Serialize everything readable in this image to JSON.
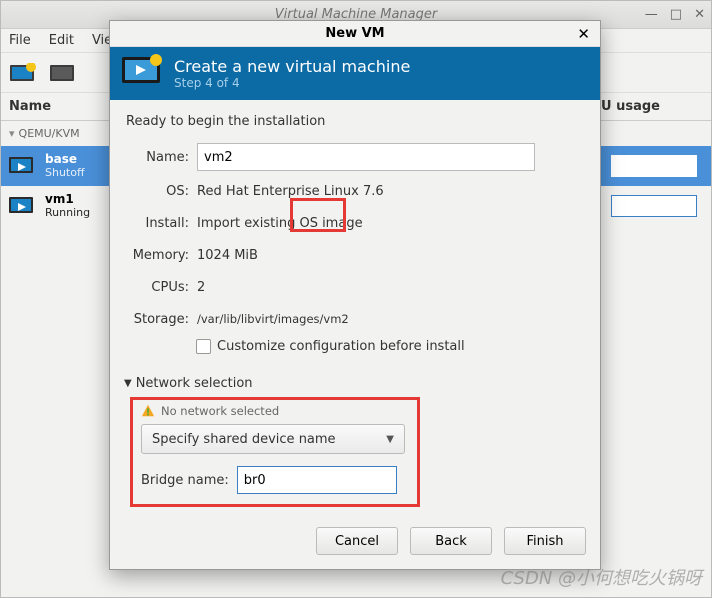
{
  "main_window": {
    "title": "Virtual Machine Manager",
    "menu": {
      "file": "File",
      "edit": "Edit",
      "view": "Vie"
    },
    "columns": {
      "name": "Name",
      "cpu": "U usage"
    },
    "connection": "QEMU/KVM",
    "vms": [
      {
        "name": "base",
        "state": "Shutoff",
        "selected": true
      },
      {
        "name": "vm1",
        "state": "Running",
        "selected": false
      }
    ]
  },
  "dialog": {
    "title": "New VM",
    "banner": {
      "heading": "Create a new virtual machine",
      "step": "Step 4 of 4"
    },
    "ready": "Ready to begin the installation",
    "labels": {
      "name": "Name:",
      "os": "OS:",
      "install": "Install:",
      "memory": "Memory:",
      "cpus": "CPUs:",
      "storage": "Storage:"
    },
    "values": {
      "name": "vm2",
      "os": "Red Hat Enterprise Linux 7.6",
      "install": "Import existing OS image",
      "memory": "1024 MiB",
      "cpus": "2",
      "storage": "/var/lib/libvirt/images/vm2"
    },
    "customize_label": "Customize configuration before install",
    "network": {
      "section": "Network selection",
      "warning": "No network selected",
      "combo": "Specify shared device name",
      "bridge_label": "Bridge name:",
      "bridge_value": "br0"
    },
    "buttons": {
      "cancel": "Cancel",
      "back": "Back",
      "finish": "Finish"
    }
  },
  "watermark": "CSDN @小何想吃火锅呀"
}
